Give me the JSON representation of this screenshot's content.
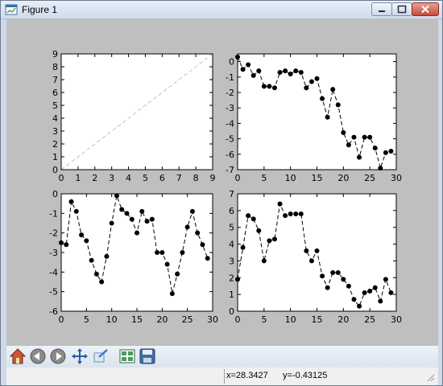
{
  "window": {
    "title": "Figure 1"
  },
  "status": {
    "x_readout": "x=28.3427",
    "y_readout": "y=-0.43125"
  },
  "toolbar": {
    "buttons": [
      "home-icon",
      "back-icon",
      "forward-icon",
      "pan-icon",
      "zoom-icon",
      "subplots-icon",
      "save-icon"
    ]
  },
  "colors": {
    "figure_bg": "#bfbfbf",
    "axes_bg": "#ffffff",
    "marker": "#000000",
    "diag_line": "#c0c0c0"
  },
  "chart_data": [
    {
      "type": "line",
      "x": [
        0,
        9
      ],
      "series": [
        {
          "values": [
            0,
            9
          ],
          "style": "dashed"
        }
      ],
      "xlim": [
        0,
        9
      ],
      "ylim": [
        0,
        9
      ],
      "xticks": [
        "0",
        "1",
        "2",
        "3",
        "4",
        "5",
        "6",
        "7",
        "8",
        "9"
      ],
      "yticks": [
        "0",
        "1",
        "2",
        "3",
        "4",
        "5",
        "6",
        "7",
        "8",
        "9"
      ],
      "title": "",
      "xlabel": "",
      "ylabel": "",
      "grid": false
    },
    {
      "type": "line",
      "x": [
        0,
        1,
        2,
        3,
        4,
        5,
        6,
        7,
        8,
        9,
        10,
        11,
        12,
        13,
        14,
        15,
        16,
        17,
        18,
        19,
        20,
        21,
        22,
        23,
        24,
        25,
        26,
        27,
        28,
        29
      ],
      "series": [
        {
          "values": [
            0.3,
            -0.5,
            -0.2,
            -0.9,
            -0.6,
            -1.6,
            -1.6,
            -1.7,
            -0.7,
            -0.6,
            -0.8,
            -0.6,
            -0.7,
            -1.7,
            -1.3,
            -1.1,
            -2.4,
            -3.6,
            -1.8,
            -2.8,
            -4.6,
            -5.4,
            -4.9,
            -6.2,
            -4.9,
            -4.9,
            -5.6,
            -6.9,
            -5.9,
            -5.8
          ],
          "style": "dashed-markers"
        }
      ],
      "xlim": [
        0,
        30
      ],
      "ylim": [
        -7,
        0.5
      ],
      "xticks": [
        "0",
        "5",
        "10",
        "15",
        "20",
        "25",
        "30"
      ],
      "yticks": [
        "0",
        "-1",
        "-2",
        "-3",
        "-4",
        "-5",
        "-6",
        "-7"
      ],
      "title": "",
      "xlabel": "",
      "ylabel": "",
      "grid": false
    },
    {
      "type": "line",
      "x": [
        0,
        1,
        2,
        3,
        4,
        5,
        6,
        7,
        8,
        9,
        10,
        11,
        12,
        13,
        14,
        15,
        16,
        17,
        18,
        19,
        20,
        21,
        22,
        23,
        24,
        25,
        26,
        27,
        28,
        29
      ],
      "series": [
        {
          "values": [
            -2.5,
            -2.6,
            -0.4,
            -0.9,
            -2.1,
            -2.4,
            -3.4,
            -4.1,
            -4.5,
            -3.2,
            -1.5,
            -0.1,
            -0.8,
            -1.0,
            -1.3,
            -2.0,
            -0.9,
            -1.4,
            -1.3,
            -3.0,
            -3.0,
            -3.6,
            -5.1,
            -4.1,
            -3.0,
            -1.7,
            -0.9,
            -2.0,
            -2.6,
            -3.3
          ],
          "style": "dashed-markers"
        }
      ],
      "xlim": [
        0,
        30
      ],
      "ylim": [
        -6,
        0
      ],
      "xticks": [
        "0",
        "5",
        "10",
        "15",
        "20",
        "25",
        "30"
      ],
      "yticks": [
        "0",
        "-1",
        "-2",
        "-3",
        "-4",
        "-5",
        "-6"
      ],
      "title": "",
      "xlabel": "",
      "ylabel": "",
      "grid": false
    },
    {
      "type": "line",
      "x": [
        0,
        1,
        2,
        3,
        4,
        5,
        6,
        7,
        8,
        9,
        10,
        11,
        12,
        13,
        14,
        15,
        16,
        17,
        18,
        19,
        20,
        21,
        22,
        23,
        24,
        25,
        26,
        27,
        28,
        29
      ],
      "series": [
        {
          "values": [
            1.9,
            3.8,
            5.7,
            5.5,
            4.8,
            3.0,
            4.2,
            4.3,
            6.4,
            5.7,
            5.8,
            5.8,
            5.8,
            3.6,
            3.0,
            3.6,
            2.1,
            1.4,
            2.3,
            2.3,
            1.9,
            1.5,
            0.7,
            0.3,
            1.1,
            1.2,
            1.4,
            0.6,
            1.9,
            1.1
          ],
          "style": "dashed-markers"
        }
      ],
      "xlim": [
        0,
        30
      ],
      "ylim": [
        0,
        7
      ],
      "xticks": [
        "0",
        "5",
        "10",
        "15",
        "20",
        "25",
        "30"
      ],
      "yticks": [
        "0",
        "1",
        "2",
        "3",
        "4",
        "5",
        "6",
        "7"
      ],
      "title": "",
      "xlabel": "",
      "ylabel": "",
      "grid": false
    }
  ]
}
